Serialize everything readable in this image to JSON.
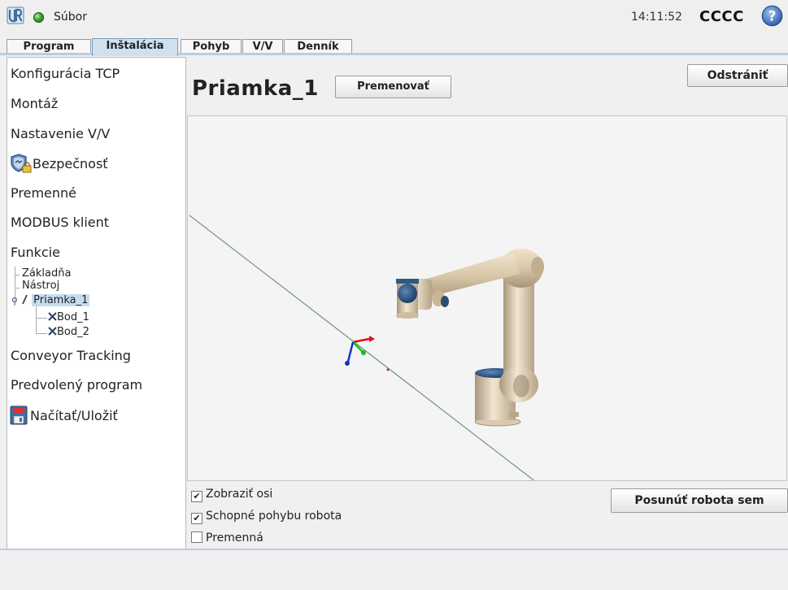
{
  "topbar": {
    "file_menu": "Súbor",
    "time": "14:11:52",
    "robot_name": "CCCC",
    "help_glyph": "?"
  },
  "tabs": [
    {
      "label": "Program",
      "active": false
    },
    {
      "label": "Inštalácia",
      "active": true
    },
    {
      "label": "Pohyb",
      "active": false
    },
    {
      "label": "V/V",
      "active": false
    },
    {
      "label": "Denník",
      "active": false
    }
  ],
  "sidebar": {
    "items": [
      {
        "label": "Konfigurácia TCP",
        "icon": null
      },
      {
        "label": "Montáž",
        "icon": null
      },
      {
        "label": "Nastavenie V/V",
        "icon": null
      },
      {
        "label": "Bezpečnosť",
        "icon": "shield-lock-icon"
      },
      {
        "label": "Premenné",
        "icon": null
      },
      {
        "label": "MODBUS klient",
        "icon": null
      },
      {
        "label": "Funkcie",
        "icon": null
      },
      {
        "label": "Conveyor Tracking",
        "icon": null
      },
      {
        "label": "Predvolený program",
        "icon": null
      },
      {
        "label": "Načítať/Uložiť",
        "icon": "floppy-disk-icon"
      }
    ],
    "feature_tree": [
      {
        "label": "Základňa"
      },
      {
        "label": "Nástroj"
      },
      {
        "label": "Priamka_1",
        "selected": true,
        "icon": "line-icon"
      },
      {
        "label": "Bod_1",
        "icon": "point-x-icon"
      },
      {
        "label": "Bod_2",
        "icon": "point-x-icon"
      }
    ]
  },
  "main": {
    "title": "Priamka_1",
    "rename_button": "Premenovať",
    "delete_button": "Odstrániť",
    "move_button": "Posunúť robota sem",
    "options": [
      {
        "label": "Zobraziť osi",
        "checked": true
      },
      {
        "label": "Schopné pohybu robota",
        "checked": true
      },
      {
        "label": "Premenná",
        "checked": false
      }
    ]
  },
  "colors": {
    "accent": "#b7cde3",
    "active_tab": "#cfe0ef",
    "robot_body": "#e6d5b8",
    "robot_cap": "#2f5a86",
    "axis_x": "#e01010",
    "axis_y": "#10c020",
    "axis_z": "#1030d0"
  }
}
